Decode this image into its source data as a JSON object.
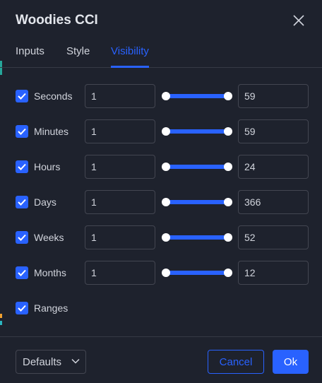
{
  "dialog": {
    "title": "Woodies CCI",
    "close_icon": "close-icon"
  },
  "tabs": [
    {
      "label": "Inputs",
      "active": false
    },
    {
      "label": "Style",
      "active": false
    },
    {
      "label": "Visibility",
      "active": true
    }
  ],
  "visibility": {
    "rows": [
      {
        "label": "Seconds",
        "checked": true,
        "min": "1",
        "max": "59"
      },
      {
        "label": "Minutes",
        "checked": true,
        "min": "1",
        "max": "59"
      },
      {
        "label": "Hours",
        "checked": true,
        "min": "1",
        "max": "24"
      },
      {
        "label": "Days",
        "checked": true,
        "min": "1",
        "max": "366"
      },
      {
        "label": "Weeks",
        "checked": true,
        "min": "1",
        "max": "52"
      },
      {
        "label": "Months",
        "checked": true,
        "min": "1",
        "max": "12"
      }
    ],
    "ranges": {
      "label": "Ranges",
      "checked": true
    }
  },
  "footer": {
    "defaults_label": "Defaults",
    "cancel_label": "Cancel",
    "ok_label": "Ok"
  },
  "colors": {
    "background": "#1e222d",
    "accent": "#2962ff",
    "text": "#d1d4dc",
    "border": "#434651"
  }
}
